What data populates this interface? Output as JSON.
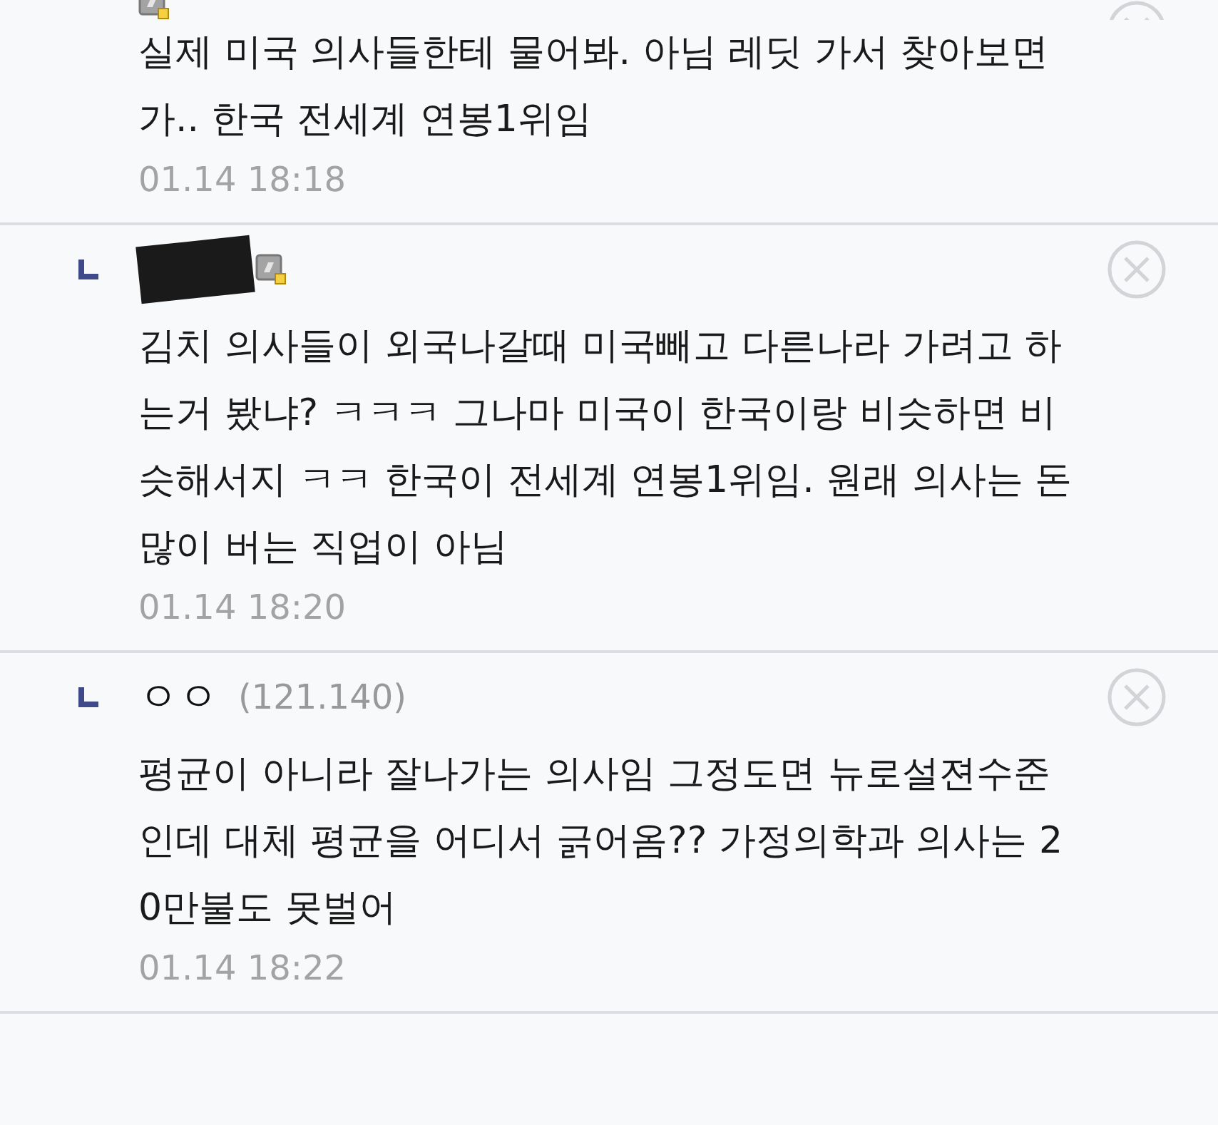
{
  "comments": [
    {
      "kind": "member",
      "lines": [
        "실제 미국 의사들한테 물어봐. 아님 레딧 가서 찾아보면",
        "가.. 한국 전세계 연봉1위임"
      ],
      "time": "01.14 18:18"
    },
    {
      "kind": "member",
      "reply": true,
      "redacted": true,
      "lines": [
        "김치 의사들이 외국나갈때 미국빼고 다른나라 가려고 하",
        "는거 봤냐? ㅋㅋㅋ 그나마 미국이 한국이랑 비슷하면 비",
        "슷해서지 ㅋㅋ 한국이 전세계 연봉1위임. 원래 의사는 돈",
        "많이 버는 직업이 아님"
      ],
      "time": "01.14 18:20"
    },
    {
      "kind": "guest",
      "reply": true,
      "author": "ㅇㅇ",
      "ip": "(121.140)",
      "lines": [
        "평균이 아니라 잘나가는 의사임 그정도면 뉴로설젼수준",
        "인데 대체 평균을 어디서 긁어옴?? 가정의학과 의사는 2",
        "0만불도 못벌어"
      ],
      "time": "01.14 18:22"
    }
  ]
}
